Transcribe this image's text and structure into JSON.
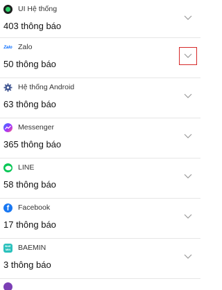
{
  "apps": [
    {
      "name": "UI Hệ thống",
      "count": "403 thông báo",
      "icon": "ui-system-icon",
      "color": "#1e1e1e"
    },
    {
      "name": "Zalo",
      "count": "50 thông báo",
      "icon": "zalo-icon",
      "color": "#0068ff",
      "icon_text": "Zalo"
    },
    {
      "name": "Hệ thống Android",
      "count": "63 thông báo",
      "icon": "android-settings-icon",
      "color": "#455a94"
    },
    {
      "name": "Messenger",
      "count": "365 thông báo",
      "icon": "messenger-icon",
      "color": "#a033ff"
    },
    {
      "name": "LINE",
      "count": "58 thông báo",
      "icon": "line-icon",
      "color": "#06c755"
    },
    {
      "name": "Facebook",
      "count": "17 thông báo",
      "icon": "facebook-icon",
      "color": "#1877f2",
      "icon_text": "f"
    },
    {
      "name": "BAEMIN",
      "count": "3 thông báo",
      "icon": "baemin-icon",
      "color": "#2ac1bc",
      "icon_text": "BAE MIN"
    },
    {
      "name": "",
      "count": "",
      "icon": "app-icon",
      "color": "#7b3fb5"
    }
  ],
  "expand_icon": "chevron-down-icon"
}
